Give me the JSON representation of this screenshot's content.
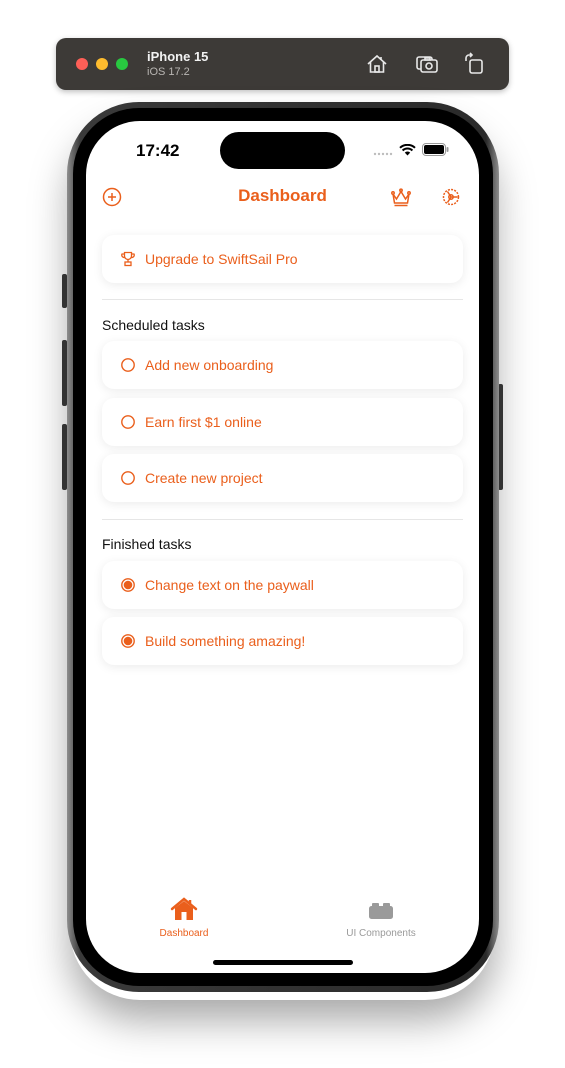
{
  "simulator": {
    "device_name": "iPhone 15",
    "os_version": "iOS 17.2",
    "buttons": [
      "home-icon",
      "screenshot-icon",
      "rotate-icon"
    ]
  },
  "status_bar": {
    "time": "17:42"
  },
  "nav": {
    "title": "Dashboard",
    "left_icon": "plus-circle-icon",
    "right_icons": [
      "crown-icon",
      "gear-icon"
    ]
  },
  "upgrade": {
    "label": "Upgrade to SwiftSail Pro",
    "icon": "trophy-icon"
  },
  "scheduled": {
    "title": "Scheduled tasks",
    "items": [
      {
        "label": "Add new onboarding",
        "done": false
      },
      {
        "label": "Earn first $1 online",
        "done": false
      },
      {
        "label": "Create new project",
        "done": false
      }
    ]
  },
  "finished": {
    "title": "Finished tasks",
    "items": [
      {
        "label": "Change text on the paywall",
        "done": true
      },
      {
        "label": "Build something amazing!",
        "done": true
      }
    ]
  },
  "tabbar": {
    "tabs": [
      {
        "label": "Dashboard",
        "icon": "house-icon",
        "active": true
      },
      {
        "label": "UI Components",
        "icon": "blocks-icon",
        "active": false
      }
    ]
  },
  "colors": {
    "accent": "#ea5f1c",
    "inactive": "#9a9a9a"
  }
}
